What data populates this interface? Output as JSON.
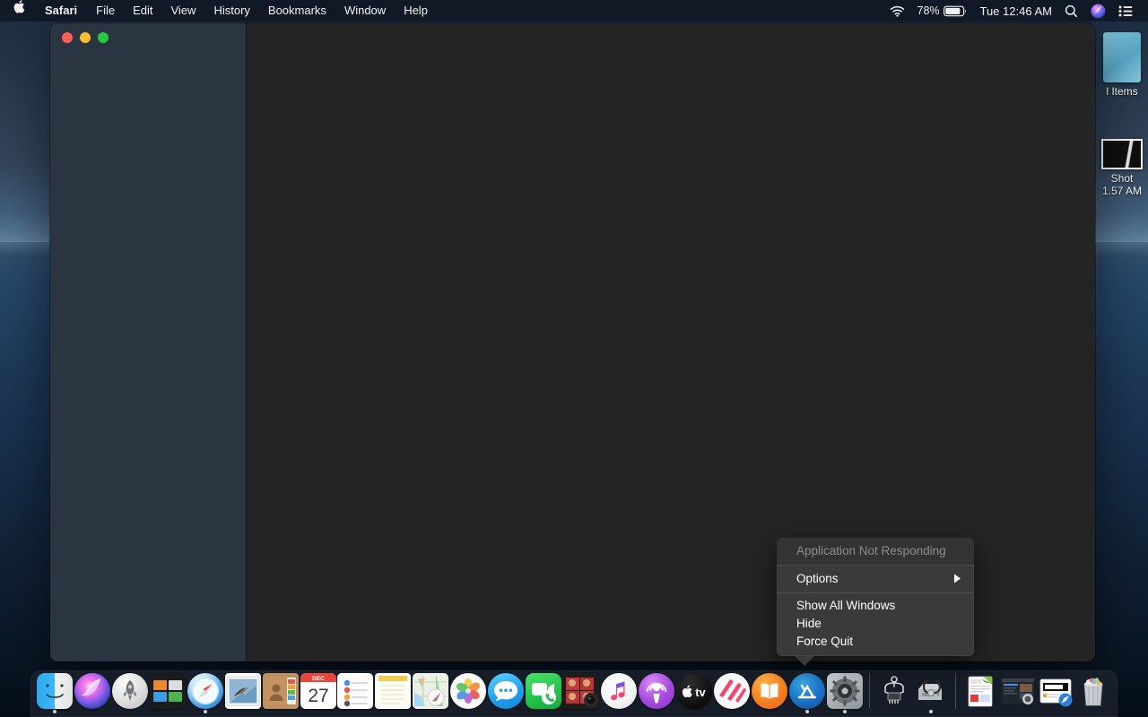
{
  "menubar": {
    "apple_icon": "apple-logo-icon",
    "left_items": [
      {
        "label": "Safari",
        "bold": true
      },
      {
        "label": "File",
        "bold": false
      },
      {
        "label": "Edit",
        "bold": false
      },
      {
        "label": "View",
        "bold": false
      },
      {
        "label": "History",
        "bold": false
      },
      {
        "label": "Bookmarks",
        "bold": false
      },
      {
        "label": "Window",
        "bold": false
      },
      {
        "label": "Help",
        "bold": false
      }
    ],
    "right": {
      "wifi_icon": "wifi-icon",
      "battery_percent": "78%",
      "battery_icon": "battery-icon",
      "clock": "Tue 12:46 AM",
      "search_icon": "search-icon",
      "siri_icon": "siri-icon",
      "control_center_icon": "control-center-icon"
    }
  },
  "desktop": {
    "icons": [
      {
        "name": "recovered-items-folder",
        "label": "l Items",
        "type": "document"
      },
      {
        "name": "screenshot-file",
        "label_line1": "Shot",
        "label_line2": "1.57 AM",
        "type": "screenshot"
      }
    ]
  },
  "window": {
    "traffic_lights": {
      "close": "close-button",
      "minimize": "minimize-button",
      "zoom": "zoom-button"
    },
    "sidebar_color": "#2b3542",
    "content_color": "#242424"
  },
  "context_menu": {
    "header": "Application Not Responding",
    "items": [
      {
        "label": "Options",
        "has_submenu": true
      },
      {
        "label": "Show All Windows",
        "has_submenu": false
      },
      {
        "label": "Hide",
        "has_submenu": false
      },
      {
        "label": "Force Quit",
        "has_submenu": false
      }
    ],
    "background_color": "#3a3a3a",
    "header_color": "#8d8d8d"
  },
  "dock": {
    "items": [
      {
        "name": "finder",
        "label": "Finder",
        "running": true
      },
      {
        "name": "siri",
        "label": "Siri",
        "running": false
      },
      {
        "name": "launchpad",
        "label": "Launchpad",
        "running": false
      },
      {
        "name": "mission-control",
        "label": "Mission Control",
        "running": false
      },
      {
        "name": "safari",
        "label": "Safari",
        "running": true
      },
      {
        "name": "mail",
        "label": "Mail",
        "running": false
      },
      {
        "name": "contacts",
        "label": "Contacts",
        "running": false
      },
      {
        "name": "calendar",
        "label": "Calendar",
        "running": false,
        "badge": "27",
        "month": "DEC"
      },
      {
        "name": "reminders",
        "label": "Reminders",
        "running": false
      },
      {
        "name": "notes",
        "label": "Notes",
        "running": false
      },
      {
        "name": "maps",
        "label": "Maps",
        "running": false
      },
      {
        "name": "photos",
        "label": "Photos",
        "running": false
      },
      {
        "name": "messages",
        "label": "Messages",
        "running": false
      },
      {
        "name": "facetime",
        "label": "FaceTime",
        "running": false
      },
      {
        "name": "photo-booth",
        "label": "Photo Booth",
        "running": false
      },
      {
        "name": "music",
        "label": "Music",
        "running": false
      },
      {
        "name": "podcasts",
        "label": "Podcasts",
        "running": false
      },
      {
        "name": "apple-tv",
        "label": "TV",
        "running": false
      },
      {
        "name": "news",
        "label": "News",
        "running": false
      },
      {
        "name": "books",
        "label": "Books",
        "running": false
      },
      {
        "name": "app-store",
        "label": "App Store",
        "running": true
      },
      {
        "name": "system-preferences",
        "label": "System Preferences",
        "running": true
      },
      {
        "name": "separator-1",
        "label": "",
        "separator": true
      },
      {
        "name": "xcode",
        "label": "Xcode",
        "running": false
      },
      {
        "name": "disk-utility",
        "label": "Disk Utility",
        "running": true
      },
      {
        "name": "separator-2",
        "label": "",
        "separator": true
      },
      {
        "name": "documents-stack",
        "label": "Documents",
        "running": false
      },
      {
        "name": "screenshots-stack",
        "label": "Screenshots",
        "running": false
      },
      {
        "name": "downloads-item",
        "label": "Downloads",
        "running": false
      },
      {
        "name": "trash",
        "label": "Trash",
        "running": false
      }
    ]
  }
}
